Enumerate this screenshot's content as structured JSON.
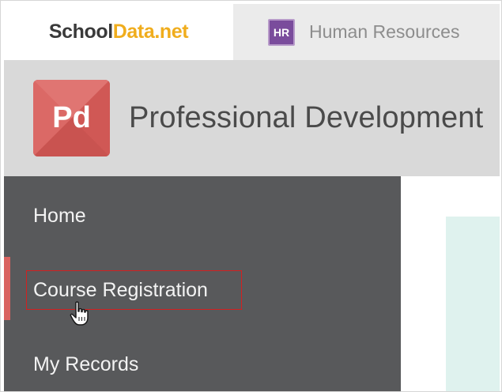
{
  "topbar": {
    "brand_part1": "School",
    "brand_part2": "Data.net",
    "hr_badge": "HR",
    "hr_label": "Human Resources"
  },
  "header": {
    "logo_text": "Pd",
    "title": "Professional Development"
  },
  "sidebar": {
    "items": [
      {
        "label": "Home"
      },
      {
        "label": "Course Registration",
        "active": true
      },
      {
        "label": "My Records"
      }
    ]
  },
  "colors": {
    "brand_dark": "#3a3a3a",
    "brand_accent": "#f0ad1d",
    "hr_purple": "#7a4c9c",
    "pd_red": "#d9625f",
    "sidebar_bg": "#58595b",
    "header_bg": "#d9d9d9",
    "highlight_border": "#d32020",
    "content_panel": "#dff2ee"
  },
  "icons": {
    "cursor": "hand-pointer-icon"
  }
}
